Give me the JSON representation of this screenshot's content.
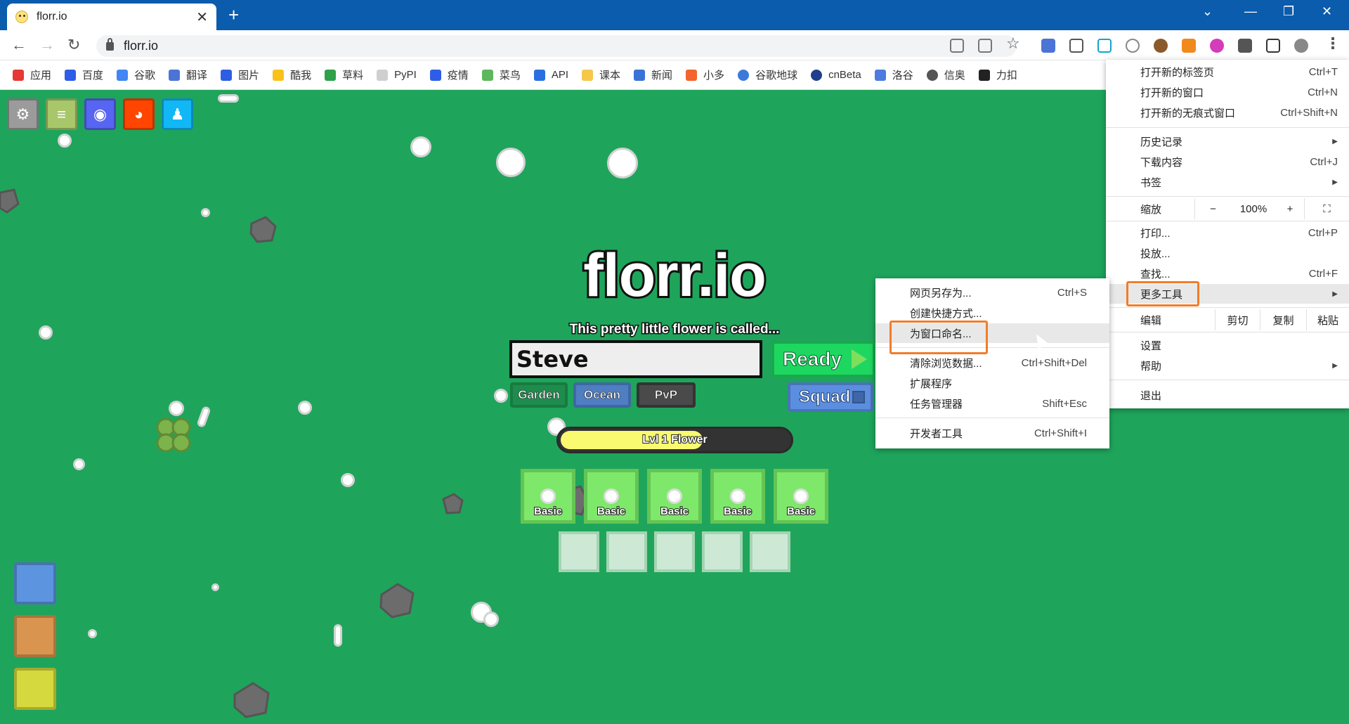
{
  "tab": {
    "title": "florr.io"
  },
  "address_bar": {
    "url": "florr.io"
  },
  "bookmarks": [
    {
      "label": "应用",
      "color": "#e53935"
    },
    {
      "label": "百度",
      "color": "#2f5ee6"
    },
    {
      "label": "谷歌",
      "color": "#4285f4"
    },
    {
      "label": "翻译",
      "color": "#4b74d6"
    },
    {
      "label": "图片",
      "color": "#2f5ee6"
    },
    {
      "label": "酷我",
      "color": "#f9c21b"
    },
    {
      "label": "草料",
      "color": "#2ea14a"
    },
    {
      "label": "PyPI",
      "color": "#cfcfcf"
    },
    {
      "label": "疫情",
      "color": "#2f5ee6"
    },
    {
      "label": "菜鸟",
      "color": "#5cb85c"
    },
    {
      "label": "API",
      "color": "#2a6fe0"
    },
    {
      "label": "课本",
      "color": "#f5c84a"
    },
    {
      "label": "新闻",
      "color": "#3a73d8"
    },
    {
      "label": "小多",
      "color": "#f2652c"
    },
    {
      "label": "谷歌地球",
      "color": "#3b7ad9"
    },
    {
      "label": "cnBeta",
      "color": "#1f3f8a"
    },
    {
      "label": "洛谷",
      "color": "#4d7be0"
    },
    {
      "label": "信奥",
      "color": "#555555"
    },
    {
      "label": "力扣",
      "color": "#222222"
    }
  ],
  "game": {
    "logo": "florr.io",
    "subtitle": "This pretty little flower is called...",
    "name_value": "Steve",
    "ready_label": "Ready",
    "squad_label": "Squad",
    "modes": [
      "Garden",
      "Ocean",
      "PvP"
    ],
    "level_label": "Lvl 1 Flower",
    "level_progress": 0.62,
    "slots": [
      "Basic",
      "Basic",
      "Basic",
      "Basic",
      "Basic"
    ],
    "secondary_slot_count": 5
  },
  "main_menu": {
    "items": {
      "new_tab": {
        "label": "打开新的标签页",
        "shortcut": "Ctrl+T"
      },
      "new_window": {
        "label": "打开新的窗口",
        "shortcut": "Ctrl+N"
      },
      "incognito": {
        "label": "打开新的无痕式窗口",
        "shortcut": "Ctrl+Shift+N"
      },
      "history": {
        "label": "历史记录"
      },
      "downloads": {
        "label": "下载内容",
        "shortcut": "Ctrl+J"
      },
      "bookmarks": {
        "label": "书签"
      },
      "zoom": {
        "label": "缩放",
        "minus": "−",
        "value": "100%",
        "plus": "+"
      },
      "print": {
        "label": "打印...",
        "shortcut": "Ctrl+P"
      },
      "cast": {
        "label": "投放..."
      },
      "find": {
        "label": "查找...",
        "shortcut": "Ctrl+F"
      },
      "more_tools": {
        "label": "更多工具"
      },
      "edit": {
        "label": "编辑",
        "cut": "剪切",
        "copy": "复制",
        "paste": "粘贴"
      },
      "settings": {
        "label": "设置"
      },
      "help": {
        "label": "帮助"
      },
      "exit": {
        "label": "退出"
      }
    }
  },
  "more_tools_menu": {
    "save_as": {
      "label": "网页另存为...",
      "shortcut": "Ctrl+S"
    },
    "create_shortcut": {
      "label": "创建快捷方式..."
    },
    "name_window": {
      "label": "为窗口命名..."
    },
    "clear_data": {
      "label": "清除浏览数据...",
      "shortcut": "Ctrl+Shift+Del"
    },
    "extensions": {
      "label": "扩展程序"
    },
    "task_manager": {
      "label": "任务管理器",
      "shortcut": "Shift+Esc"
    },
    "dev_tools": {
      "label": "开发者工具",
      "shortcut": "Ctrl+Shift+I"
    }
  },
  "colors": {
    "accent_highlight": "#f07d2a",
    "game_bg": "#1ea55b",
    "titlebar": "#0b5cad"
  }
}
